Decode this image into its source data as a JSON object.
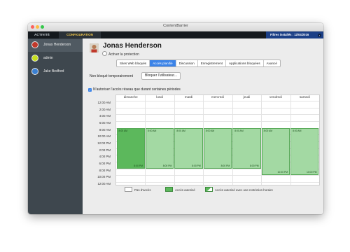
{
  "window": {
    "title": "ContentBarrier"
  },
  "topbar": {
    "tab_activity": "ACTIVITÉ",
    "tab_config": "CONFIGURATION",
    "filters": "Filtres installés : 12/04/2016"
  },
  "sidebar": {
    "users": [
      {
        "name": "Jonas Henderson",
        "selected": true,
        "avatar_color": "#c0392b"
      },
      {
        "name": "admin",
        "selected": false,
        "avatar_color": "#c6e01e"
      },
      {
        "name": "Jake Bedford",
        "selected": false,
        "avatar_color": "#3a80d2"
      }
    ]
  },
  "profile": {
    "name": "Jonas Henderson",
    "protection_label": "Activer la protection"
  },
  "tabs": [
    {
      "label": "Sites Web bloqués",
      "active": false
    },
    {
      "label": "Accès planifié",
      "active": true
    },
    {
      "label": "Discussion",
      "active": false
    },
    {
      "label": "Enregistrement",
      "active": false
    },
    {
      "label": "Applications bloquées",
      "active": false
    },
    {
      "label": "Avancé",
      "active": false
    }
  ],
  "temp": {
    "label": "Non bloqué temporairement",
    "button": "Bloquer l'utilisateur..."
  },
  "restrict_label": "N'autoriser l'accès réseau que durant certaines périodes",
  "schedule": {
    "days": [
      "dimanche",
      "lundi",
      "mardi",
      "mercredi",
      "jeudi",
      "vendredi",
      "samedi"
    ],
    "times": [
      "12:00 AM",
      "2:00 AM",
      "4:00 AM",
      "6:00 AM",
      "8:00 AM",
      "10:00 AM",
      "12:00 PM",
      "2:00 PM",
      "4:00 PM",
      "6:00 PM",
      "8:00 PM",
      "10:00 PM",
      "12:00 AM"
    ],
    "blocks": [
      {
        "start": "8:00 AM",
        "end": "8:00 PM"
      },
      {
        "start": "8:00 AM",
        "end": "8:00 PM"
      },
      {
        "start": "8:00 AM",
        "end": "8:00 PM"
      },
      {
        "start": "8:00 AM",
        "end": "8:00 PM"
      },
      {
        "start": "8:00 AM",
        "end": "8:00 PM"
      },
      {
        "start": "8:00 AM",
        "end": "10:00 PM"
      },
      {
        "start": "8:00 AM",
        "end": "10:00 PM"
      }
    ]
  },
  "legend": {
    "none": "Pas d'accès",
    "allowed": "Accès autorisé",
    "restricted": "Accès autorisé avec une restriction horaire"
  },
  "colors": {
    "allowed": "#5cb85c",
    "allowed_light": "#a3d9a3",
    "accent": "#3b83e8"
  }
}
